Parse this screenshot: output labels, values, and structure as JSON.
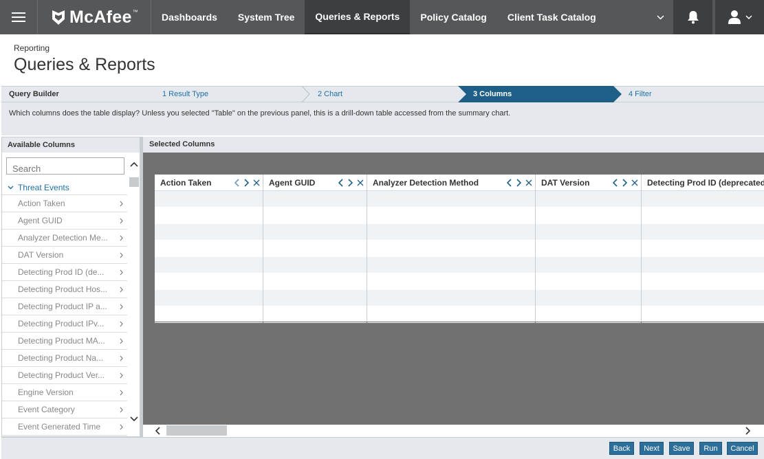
{
  "nav": {
    "brand": "McAfee",
    "brand_mark": "™",
    "tabs": [
      {
        "label": "Dashboards",
        "active": false
      },
      {
        "label": "System Tree",
        "active": false
      },
      {
        "label": "Queries & Reports",
        "active": true
      },
      {
        "label": "Policy Catalog",
        "active": false
      },
      {
        "label": "Client Task Catalog",
        "active": false
      }
    ]
  },
  "header": {
    "breadcrumb": "Reporting",
    "title": "Queries & Reports"
  },
  "wizard": {
    "title": "Query Builder",
    "steps": [
      {
        "label": "1 Result Type",
        "active": false
      },
      {
        "label": "2 Chart",
        "active": false
      },
      {
        "label": "3 Columns",
        "active": true
      },
      {
        "label": "4 Filter",
        "active": false
      }
    ],
    "instructions": "Which columns does the table display? Unless you selected \"Table\" on the previous panel, this is a drill-down table accessed from the summary chart."
  },
  "available": {
    "heading": "Available Columns",
    "search_placeholder": "Search",
    "group": "Threat Events",
    "items": [
      "Action Taken",
      "Agent GUID",
      "Analyzer Detection Me...",
      "DAT Version",
      "Detecting Prod ID (de...",
      "Detecting Product Hos...",
      "Detecting Product IP a...",
      "Detecting Product IPv...",
      "Detecting Product MA...",
      "Detecting Product Na...",
      "Detecting Product Ver...",
      "Engine Version",
      "Event Category",
      "Event Generated Time"
    ]
  },
  "selected": {
    "heading": "Selected Columns",
    "columns": [
      {
        "label": "Action Taken"
      },
      {
        "label": "Agent GUID"
      },
      {
        "label": "Analyzer Detection Method"
      },
      {
        "label": "DAT Version"
      },
      {
        "label": "Detecting Prod ID (deprecated)"
      }
    ]
  },
  "footer": {
    "back": "Back",
    "next": "Next",
    "save": "Save",
    "run": "Run",
    "cancel": "Cancel"
  },
  "colors": {
    "nav_bg": "#555759",
    "nav_active": "#3c3e40",
    "accent": "#1d6fa5",
    "active_step": "#1d5f87",
    "button": "#2c6f9a"
  }
}
